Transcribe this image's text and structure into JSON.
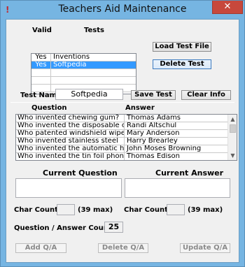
{
  "window": {
    "title": "Teachers Aid Maintenance",
    "app_icon": "!",
    "close_glyph": "✕"
  },
  "tests": {
    "col_valid": "Valid",
    "col_tests": "Tests",
    "rows": [
      {
        "valid": "Yes",
        "test": "Inventions",
        "selected": false
      },
      {
        "valid": "Yes",
        "test": "Softpedia",
        "selected": true
      },
      {
        "valid": "",
        "test": "",
        "selected": false
      },
      {
        "valid": "",
        "test": "",
        "selected": false
      },
      {
        "valid": "",
        "test": "",
        "selected": false
      }
    ],
    "load_button": "Load Test File",
    "delete_button": "Delete Test"
  },
  "test_name": {
    "label": "Test Name:",
    "value": "Softpedia",
    "save_button": "Save Test",
    "clear_button": "Clear Info"
  },
  "qa": {
    "col_question": "Question",
    "col_answer": "Answer",
    "rows": [
      {
        "question": "Who invented chewing gum?",
        "answer": "Thomas Adams"
      },
      {
        "question": "Who invented the disposable cell p...",
        "answer": "Randi Altschul"
      },
      {
        "question": "Who patented windshield wipers?",
        "answer": "Mary Anderson"
      },
      {
        "question": "Who invented stainless steel",
        "answer": "Harry Brearley"
      },
      {
        "question": "Who invented the automatic hand ...",
        "answer": "John Moses Browning"
      },
      {
        "question": "Who invented the tin foil phonogra...",
        "answer": "Thomas Edison"
      }
    ]
  },
  "edit": {
    "current_question_label": "Current Question",
    "current_answer_label": "Current Answer",
    "char_count_label": "Char Count:",
    "max_label": "(39 max)",
    "count_label": "Question / Answer Count:",
    "count_value": "25"
  },
  "actions": {
    "add": "Add Q/A",
    "delete": "Delete Q/A",
    "update": "Update Q/A"
  }
}
